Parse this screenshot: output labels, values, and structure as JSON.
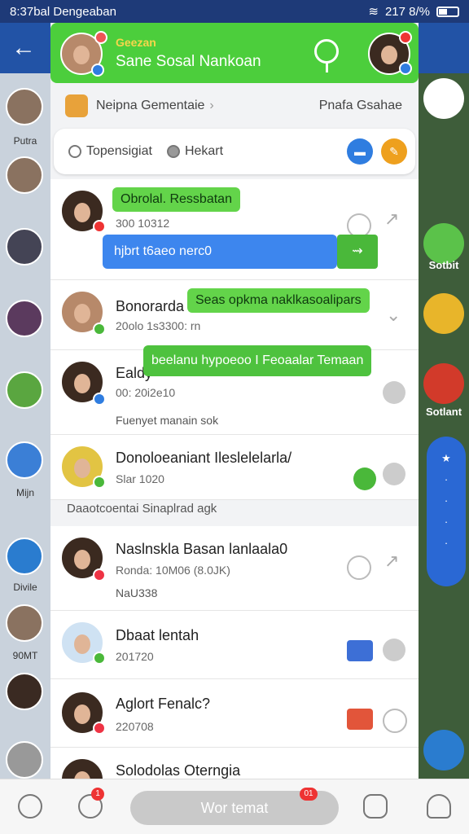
{
  "statusbar": {
    "time_title": "8:37bal Dengeaban",
    "signal": "217 8/%"
  },
  "header": {
    "subtitle": "Geezan",
    "title": "Sane Sosal Nankoan"
  },
  "subrow": {
    "left": "Neipna Gementaie",
    "right": "Pnafa Gsahae"
  },
  "tabs": {
    "tab1": "Topensigiat",
    "tab2": "Hekart"
  },
  "rows": [
    {
      "name": "",
      "meta": "300 10312"
    },
    {
      "name": "Bonorarda",
      "meta": "20olo 1s3300: rn"
    },
    {
      "name": "Ealdy",
      "meta": "00: 20i2e10",
      "extra": "Fuenyet manain sok"
    },
    {
      "name": "Donoloeaniant Ileslelelarla/",
      "meta": "Slar 1020"
    },
    {
      "name": "Naslnskla Basan lanlaala0",
      "meta": "Ronda: 10M06 (8.0JK)",
      "extra": "NaU338"
    },
    {
      "name": "Dbaat lentah",
      "meta": "201720"
    },
    {
      "name": "Aglort Fenalc?",
      "meta": "220708"
    },
    {
      "name": "Solodolas Oterngia",
      "meta": ""
    }
  ],
  "overlays": {
    "toast1": "Obrolal. Ressbatan",
    "blue_bar": "hjbrt t6aeo nerc0",
    "toast2": "Seas opkma naklkasoalipars",
    "toast3": "beelanu hypoeoo I Feoaalar Temaan"
  },
  "section_label": "Daaotcoentai Sinaplrad agk",
  "left_rail": {
    "label1": "Putra",
    "label2": "Mijn",
    "label3": "Divile",
    "label4": "90MT"
  },
  "right_rail": {
    "label1": "Sotbit",
    "label2": "Sotlant"
  },
  "bottom_nav": {
    "pill_label": "Wor temat",
    "badge1": "1",
    "badge2": "01"
  },
  "colors": {
    "green": "#4cce3c",
    "blue": "#3d86ee",
    "header_blue": "#2253a6"
  },
  "icons": [
    "back-arrow-icon",
    "search-icon",
    "chat-bubble-icon",
    "share-icon",
    "home-icon",
    "chat-icon",
    "user-icon"
  ]
}
